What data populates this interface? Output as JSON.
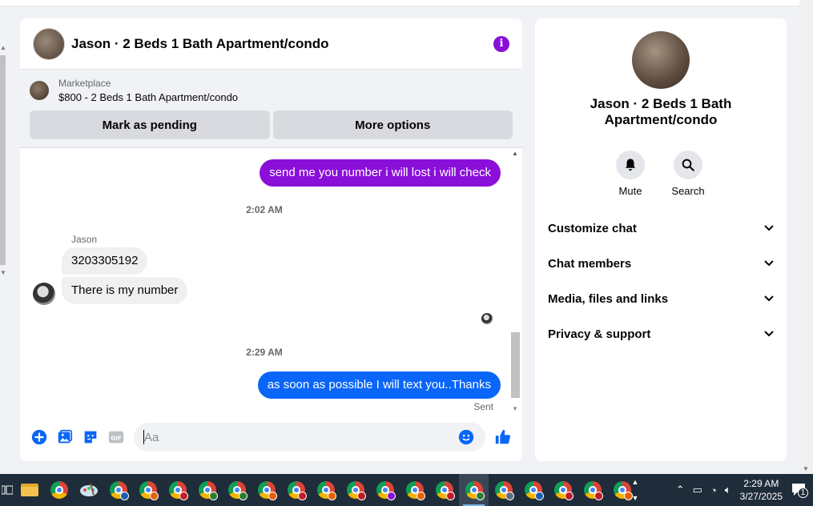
{
  "chat": {
    "title": "Jason · 2 Beds 1 Bath Apartment/condo",
    "marketplace": {
      "label": "Marketplace",
      "listing": "$800 - 2 Beds 1 Bath Apartment/condo",
      "mark_pending_label": "Mark as pending",
      "more_options_label": "More options"
    },
    "messages": {
      "outgoing_1": "send me you number i will lost i will check",
      "timestamp_1": "2:02 AM",
      "sender_name": "Jason",
      "incoming_1": "3203305192",
      "incoming_2": "There is my number",
      "timestamp_2": "2:29 AM",
      "outgoing_2": "as soon as possible I will text you..Thanks",
      "status": "Sent"
    },
    "composer": {
      "placeholder": "Aa"
    },
    "colors": {
      "accent": "#8a0fd9",
      "outgoing_blue": "#0a66f8"
    }
  },
  "side_panel": {
    "name": "Jason · 2 Beds 1 Bath Apartment/condo",
    "actions": [
      {
        "label": "Mute",
        "icon": "bell-icon"
      },
      {
        "label": "Search",
        "icon": "search-icon"
      }
    ],
    "sections": [
      {
        "label": "Customize chat"
      },
      {
        "label": "Chat members"
      },
      {
        "label": "Media, files and links"
      },
      {
        "label": "Privacy & support"
      }
    ]
  },
  "taskbar": {
    "time": "2:29 AM",
    "date": "3/27/2025",
    "notification_count": "1"
  }
}
